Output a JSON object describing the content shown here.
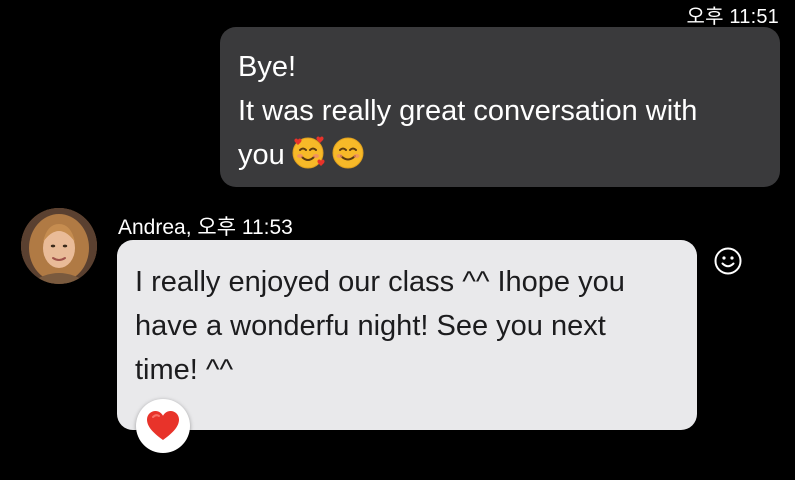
{
  "header": {
    "timestamp": "오후 11:51"
  },
  "outgoing_message": {
    "lines": [
      "Bye!",
      "It was really great conversation with",
      "you"
    ],
    "emojis": [
      "smiling-face-with-hearts-icon",
      "smiling-face-icon"
    ]
  },
  "incoming_message": {
    "sender_line": "Andrea, 오후 11:53",
    "lines": [
      "I really enjoyed our class ^^ Ihope you",
      "have a wonderfu night! See you next",
      "time! ^^"
    ],
    "reaction": "heart-icon"
  },
  "colors": {
    "background": "#000000",
    "outgoing_bubble": "#3a3a3c",
    "incoming_bubble": "#e9e9eb",
    "heart": "#e8332a"
  }
}
